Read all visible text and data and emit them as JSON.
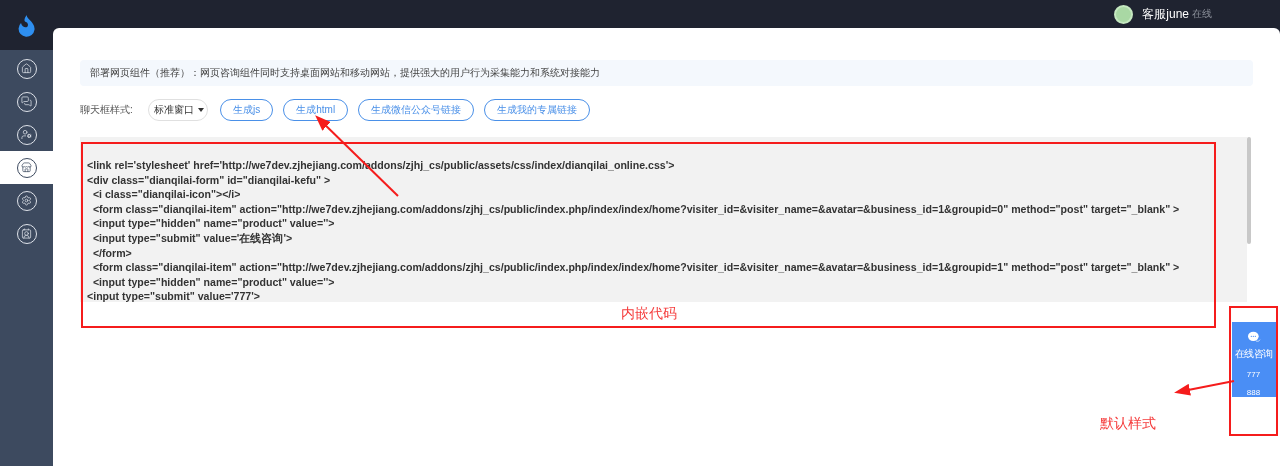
{
  "sidebar": {
    "items": [
      {
        "kind": "home",
        "selected": false
      },
      {
        "kind": "chat",
        "selected": false
      },
      {
        "kind": "user",
        "selected": false
      },
      {
        "kind": "store",
        "selected": true
      },
      {
        "kind": "gear",
        "selected": false
      },
      {
        "kind": "contact",
        "selected": false
      }
    ]
  },
  "header": {
    "user": "客服june",
    "status": "在线"
  },
  "banner": "部署网页组件（推荐）：网页咨询组件同时支持桌面网站和移动网站，提供强大的用户行为采集能力和系统对接能力",
  "toolbar": {
    "label": "聊天框样式:",
    "select": {
      "value": "标准窗口"
    },
    "buttons": [
      "生成js",
      "生成html",
      "生成微信公众号链接",
      "生成我的专属链接"
    ]
  },
  "code": {
    "lines": [
      "<link rel='stylesheet' href='http://we7dev.zjhejiang.com/addons/zjhj_cs/public/assets/css/index/dianqilai_online.css'>",
      "<div class=\"dianqilai-form\" id=\"dianqilai-kefu\" >",
      "  <i class=\"dianqilai-icon\"></i>",
      "  <form class=\"dianqilai-item\" action=\"http://we7dev.zjhejiang.com/addons/zjhj_cs/public/index.php/index/index/home?visiter_id=&visiter_name=&avatar=&business_id=1&groupid=0\" method=\"post\" target=\"_blank\" >",
      "  <input type=\"hidden\" name=\"product\" value=''>",
      "  <input type=\"submit\" value='在线咨询'>",
      "  </form>",
      "  <form class=\"dianqilai-item\" action=\"http://we7dev.zjhejiang.com/addons/zjhj_cs/public/index.php/index/index/home?visiter_id=&visiter_name=&avatar=&business_id=1&groupid=1\" method=\"post\" target=\"_blank\" >",
      "  <input type=\"hidden\" name=\"product\" value=''>",
      "<input type=\"submit\" value='777'>"
    ]
  },
  "widget": {
    "title": "在线咨询",
    "items": [
      "777",
      "888"
    ]
  },
  "annotations": [
    {
      "text": "内嵌代码"
    },
    {
      "text": "默认样式"
    }
  ]
}
